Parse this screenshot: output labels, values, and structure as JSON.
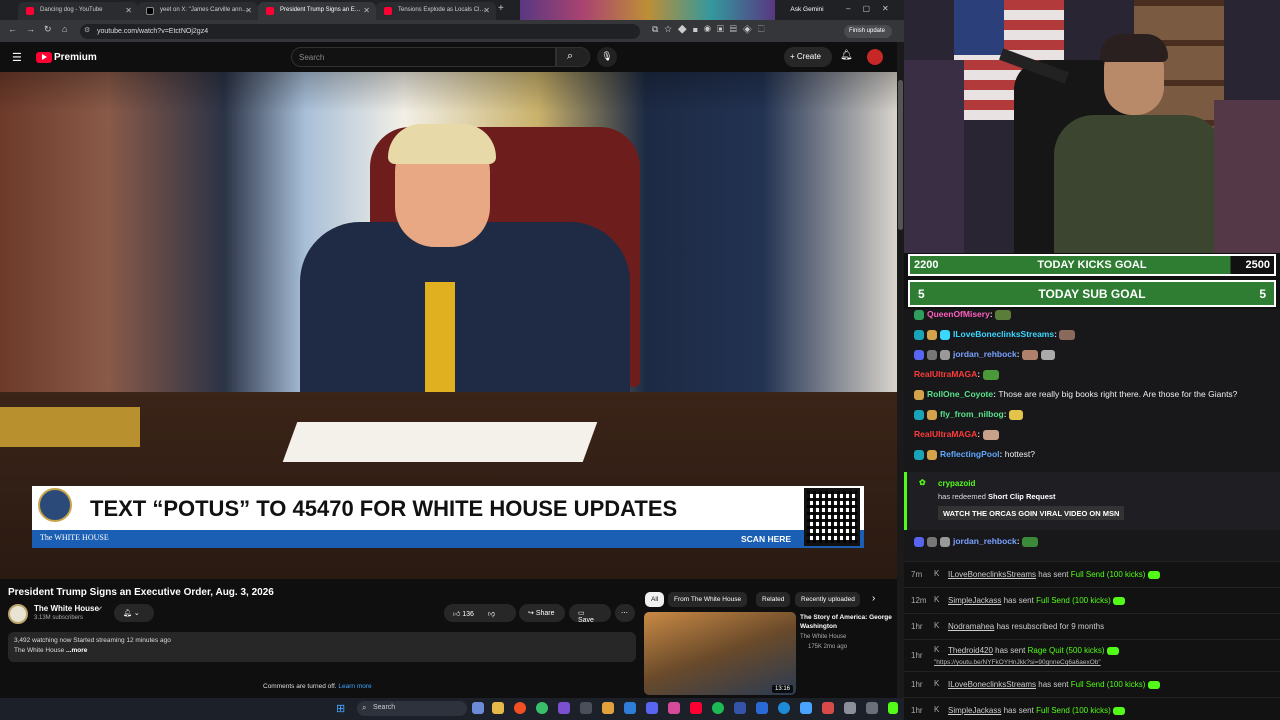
{
  "browser": {
    "tabs": [
      {
        "title": "Dancing dog - YouTube",
        "fav_color": "#ff0033"
      },
      {
        "title": "yeet on X: \"James Carville ann…",
        "fav_color": "#000000"
      },
      {
        "title": "President Trump Signs an E…",
        "fav_color": "#ff0033"
      },
      {
        "title": "Tensions Explode as Locals Cl…",
        "fav_color": "#ff0033"
      }
    ],
    "ask_gemini": "Ask Gemini",
    "url": "youtube.com/watch?v=EtctNOj2gz4",
    "finish_update": "Finish update"
  },
  "youtube": {
    "logo": "Premium",
    "search_placeholder": "Search",
    "create_label": "Create",
    "banner": {
      "headline": "TEXT “POTUS” TO 45470 FOR WHITE HOUSE UPDATES",
      "org": "The WHITE HOUSE",
      "scan": "SCAN HERE"
    },
    "video_title": "President Trump Signs an Executive Order, Aug. 3, 2026",
    "channel": "The White House",
    "subscribers": "3.13M subscribers",
    "likes": "136",
    "share_label": "Share",
    "save_label": "Save",
    "desc_line1": "3,492 watching now  Started streaming 12 minutes ago",
    "desc_line2": "The White House",
    "more": "...more",
    "comments_off": "Comments are turned off.",
    "learn_more": "Learn more",
    "chips": [
      "All",
      "From The White House",
      "Related",
      "Recently uploaded"
    ],
    "rec": {
      "title": "The Story of America: George Washington",
      "channel": "The White House",
      "meta": "175K  2mo ago",
      "duration": "13:16"
    }
  },
  "taskbar": {
    "search": "Search"
  },
  "stream": {
    "kicks_goal": {
      "current": "2200",
      "label": "TODAY KICKS GOAL",
      "target": "2500",
      "fraction": 0.88
    },
    "sub_goal": {
      "current": "5",
      "label": "TODAY SUB GOAL",
      "target": "5",
      "fraction": 1.0
    },
    "chat": [
      {
        "user": "QueenOfMisery",
        "color": "#ff5fbf",
        "text": ""
      },
      {
        "user": "ILoveBoneclinksStreams",
        "color": "#3ad7ff",
        "text": ""
      },
      {
        "user": "jordan_rehbock",
        "color": "#7aa2ff",
        "text": ""
      },
      {
        "user": "RealUltraMAGA",
        "color": "#ff3b3b",
        "text": ""
      },
      {
        "user": "RollOne_Coyote",
        "color": "#57e389",
        "text": "Those are really big books right there. Are those for the Giants?"
      },
      {
        "user": "fly_from_nilbog",
        "color": "#57e389",
        "text": ""
      },
      {
        "user": "RealUltraMAGA",
        "color": "#ff3b3b",
        "text": ""
      },
      {
        "user": "ReflectingPool",
        "color": "#5fa8ff",
        "text": "hottest?"
      }
    ],
    "redeem": {
      "user": "crypazoid",
      "action": "has redeemed",
      "reward": "Short Clip Request",
      "message": "WATCH THE ORCAS GOIN VIRAL VIDEO ON MSN"
    },
    "last_chat_user": "jordan_rehbock",
    "kick_events": [
      {
        "time": "7m",
        "user": "ILoveBoneclinksStreams",
        "verb": "has sent",
        "item": "Full Send (100 kicks)",
        "extra": ""
      },
      {
        "time": "12m",
        "user": "SimpleJackass",
        "verb": "has sent",
        "item": "Full Send (100 kicks)",
        "extra": ""
      },
      {
        "time": "1hr",
        "user": "Nodramahea",
        "verb": "has resubscribed for 9 months",
        "item": "",
        "extra": ""
      },
      {
        "time": "1hr",
        "user": "Thedroid420",
        "verb": "has sent",
        "item": "Rage Quit (500 kicks)",
        "extra": "\"https://youtu.be/NYFkOYHnJkk?si=90gnneCq6a6aexOb\""
      },
      {
        "time": "1hr",
        "user": "ILoveBoneclinksStreams",
        "verb": "has sent",
        "item": "Full Send (100 kicks)",
        "extra": ""
      },
      {
        "time": "1hr",
        "user": "SimpleJackass",
        "verb": "has sent",
        "item": "Full Send (100 kicks)",
        "extra": ""
      }
    ]
  }
}
